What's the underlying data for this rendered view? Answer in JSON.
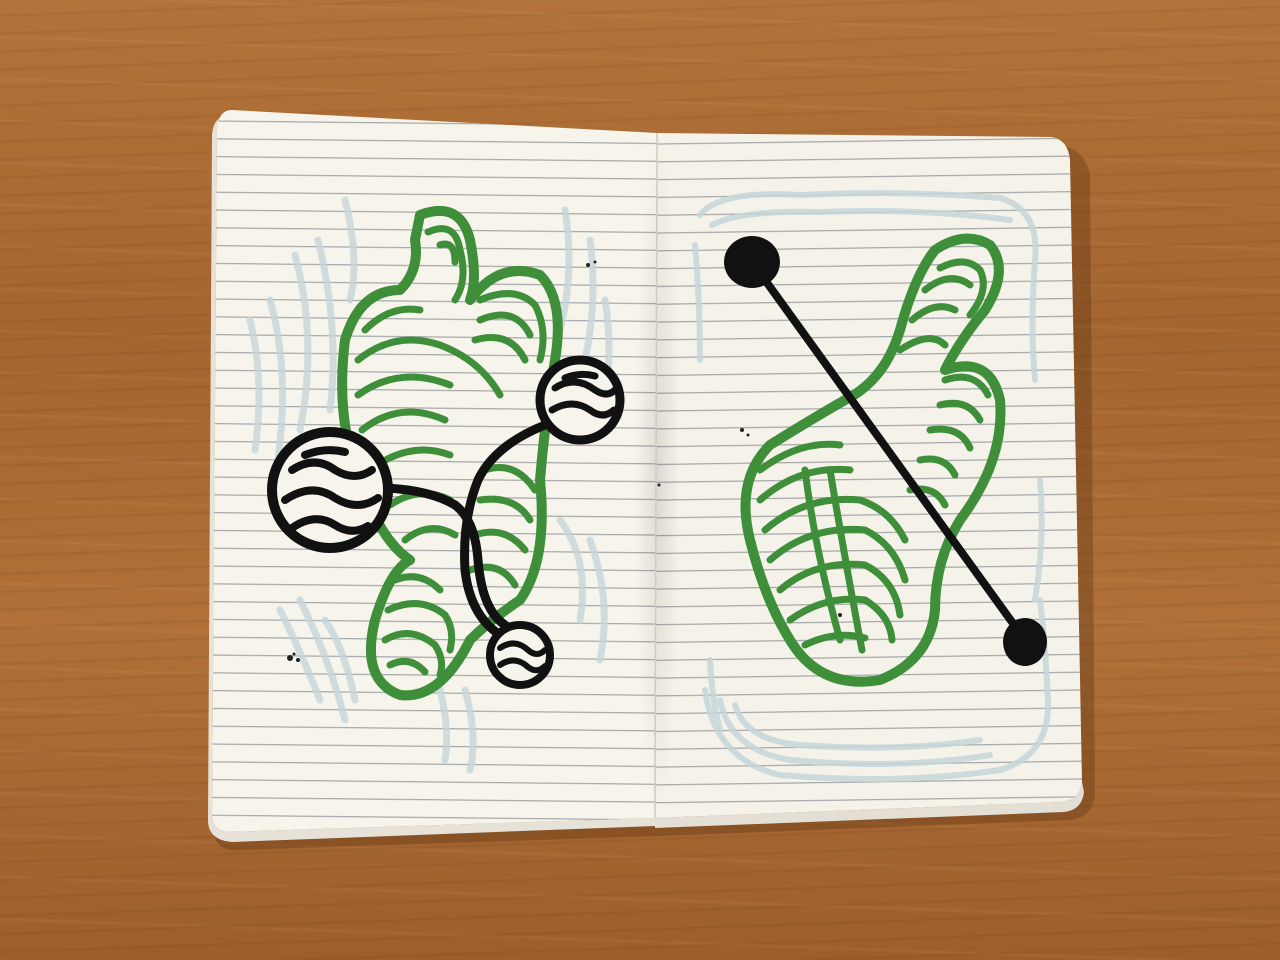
{
  "scene": {
    "description_items": [
      "notebook",
      "left-page-drawing",
      "right-page-drawing"
    ],
    "colors": {
      "desk": "#a86a33",
      "paper": "#f7f4ec",
      "rule_line": "#8a8f94",
      "green_ink": "#3f8f3a",
      "black_ink": "#111111",
      "pale_ink": "#c9d7db"
    }
  }
}
